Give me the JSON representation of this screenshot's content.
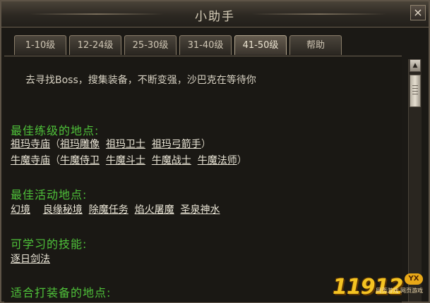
{
  "window": {
    "title": "小助手",
    "close_label": "×"
  },
  "tabs": [
    {
      "label": "1-10级",
      "active": false
    },
    {
      "label": "12-24级",
      "active": false
    },
    {
      "label": "25-30级",
      "active": false
    },
    {
      "label": "31-40级",
      "active": false
    },
    {
      "label": "41-50级",
      "active": true
    },
    {
      "label": "帮助",
      "active": false
    }
  ],
  "content": {
    "intro": "去寻找Boss，搜集装备，不断变强，沙巴克在等待你",
    "sections": {
      "best_leveling": {
        "heading": "最佳练级的地点:",
        "row1": {
          "main": "祖玛寺庙",
          "open": "（",
          "subs": [
            "祖玛雕像",
            "祖玛卫士",
            "祖玛弓箭手"
          ],
          "close": "）"
        },
        "row2": {
          "main": "牛魔寺庙",
          "open": "（",
          "subs": [
            "牛魔侍卫",
            "牛魔斗士",
            "牛魔战士",
            "牛魔法师"
          ],
          "close": "）"
        }
      },
      "best_activities": {
        "heading": "最佳活动地点:",
        "links": [
          "幻境",
          "良缘秘境",
          "除魔任务",
          "焰火屠魔",
          "圣泉神水"
        ]
      },
      "skills": {
        "heading": "可学习的技能:",
        "links": [
          "逐日剑法"
        ]
      },
      "gear": {
        "heading": "适合打装备的地点:"
      }
    }
  },
  "scrollbar": {
    "up_glyph": "▲"
  },
  "watermark": {
    "logo": "11912",
    "badge": "YX",
    "sub": "网页游戏 网页游戏"
  },
  "colors": {
    "heading": "#4fc23a",
    "link": "#ece7d8",
    "text": "#d7d1c2"
  }
}
